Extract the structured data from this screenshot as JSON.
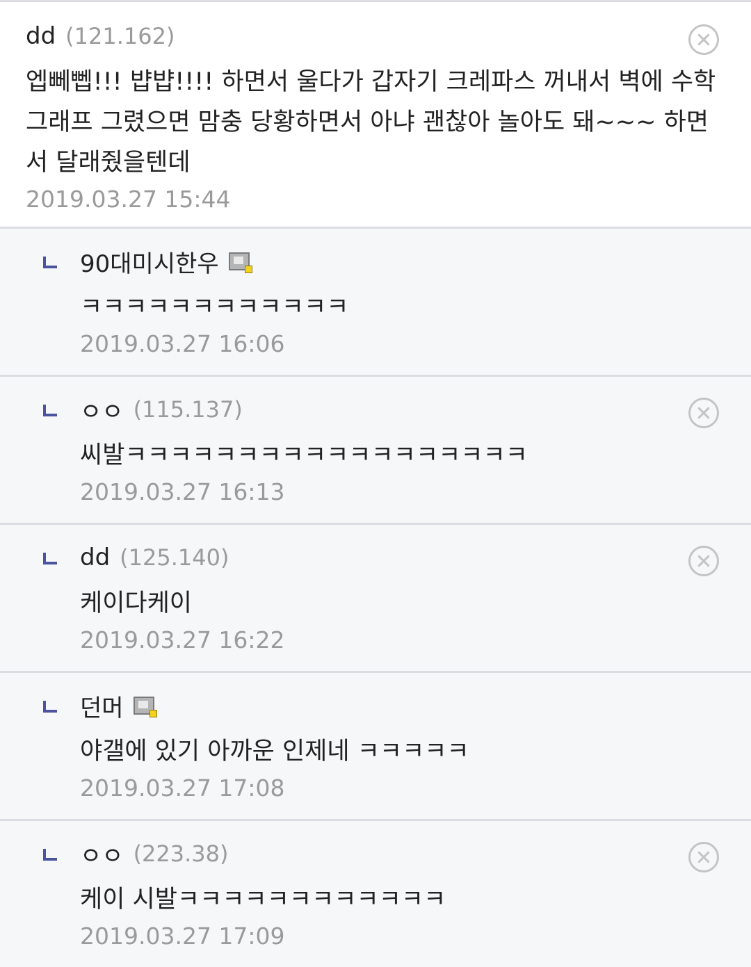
{
  "main_comment": {
    "nick": "dd",
    "ip": "(121.162)",
    "text": "엡뻬뻽!!! 뱝뱝!!!! 하면서 울다가 갑자기 크레파스 꺼내서 벽에 수학그래프 그렸으면 맘충 당황하면서 아냐 괜찮아 놀아도 돼~~~ 하면서 달래줬을텐데",
    "date": "2019.03.27 15:44",
    "delete_icon": "close-circle-icon"
  },
  "replies": [
    {
      "nick": "90대미시한우",
      "ip": "",
      "member_icon": "gallery-member-icon",
      "text": "ㅋㅋㅋㅋㅋㅋㅋㅋㅋㅋㅋㅋ",
      "date": "2019.03.27 16:06"
    },
    {
      "nick": "ㅇㅇ",
      "ip": "(115.137)",
      "text": "씨발ㅋㅋㅋㅋㅋㅋㅋㅋㅋㅋㅋㅋㅋㅋㅋㅋㅋㅋ",
      "date": "2019.03.27 16:13",
      "delete_icon": "close-circle-icon"
    },
    {
      "nick": "dd",
      "ip": "(125.140)",
      "text": "케이다케이",
      "date": "2019.03.27 16:22",
      "delete_icon": "close-circle-icon"
    },
    {
      "nick": "던머",
      "ip": "",
      "member_icon": "gallery-member-icon",
      "text": "야갤에 있기 아까운 인제네 ㅋㅋㅋㅋㅋ",
      "date": "2019.03.27 17:08"
    },
    {
      "nick": "ㅇㅇ",
      "ip": "(223.38)",
      "text": "케이 시발ㅋㅋㅋㅋㅋㅋㅋㅋㅋㅋㅋㅋ",
      "date": "2019.03.27 17:09",
      "delete_icon": "close-circle-icon"
    }
  ],
  "colors": {
    "reply_marker": "#4b53a0",
    "reply_background": "#f6f7f9",
    "divider": "#dcdde3",
    "muted_text": "#9a9a9a"
  }
}
